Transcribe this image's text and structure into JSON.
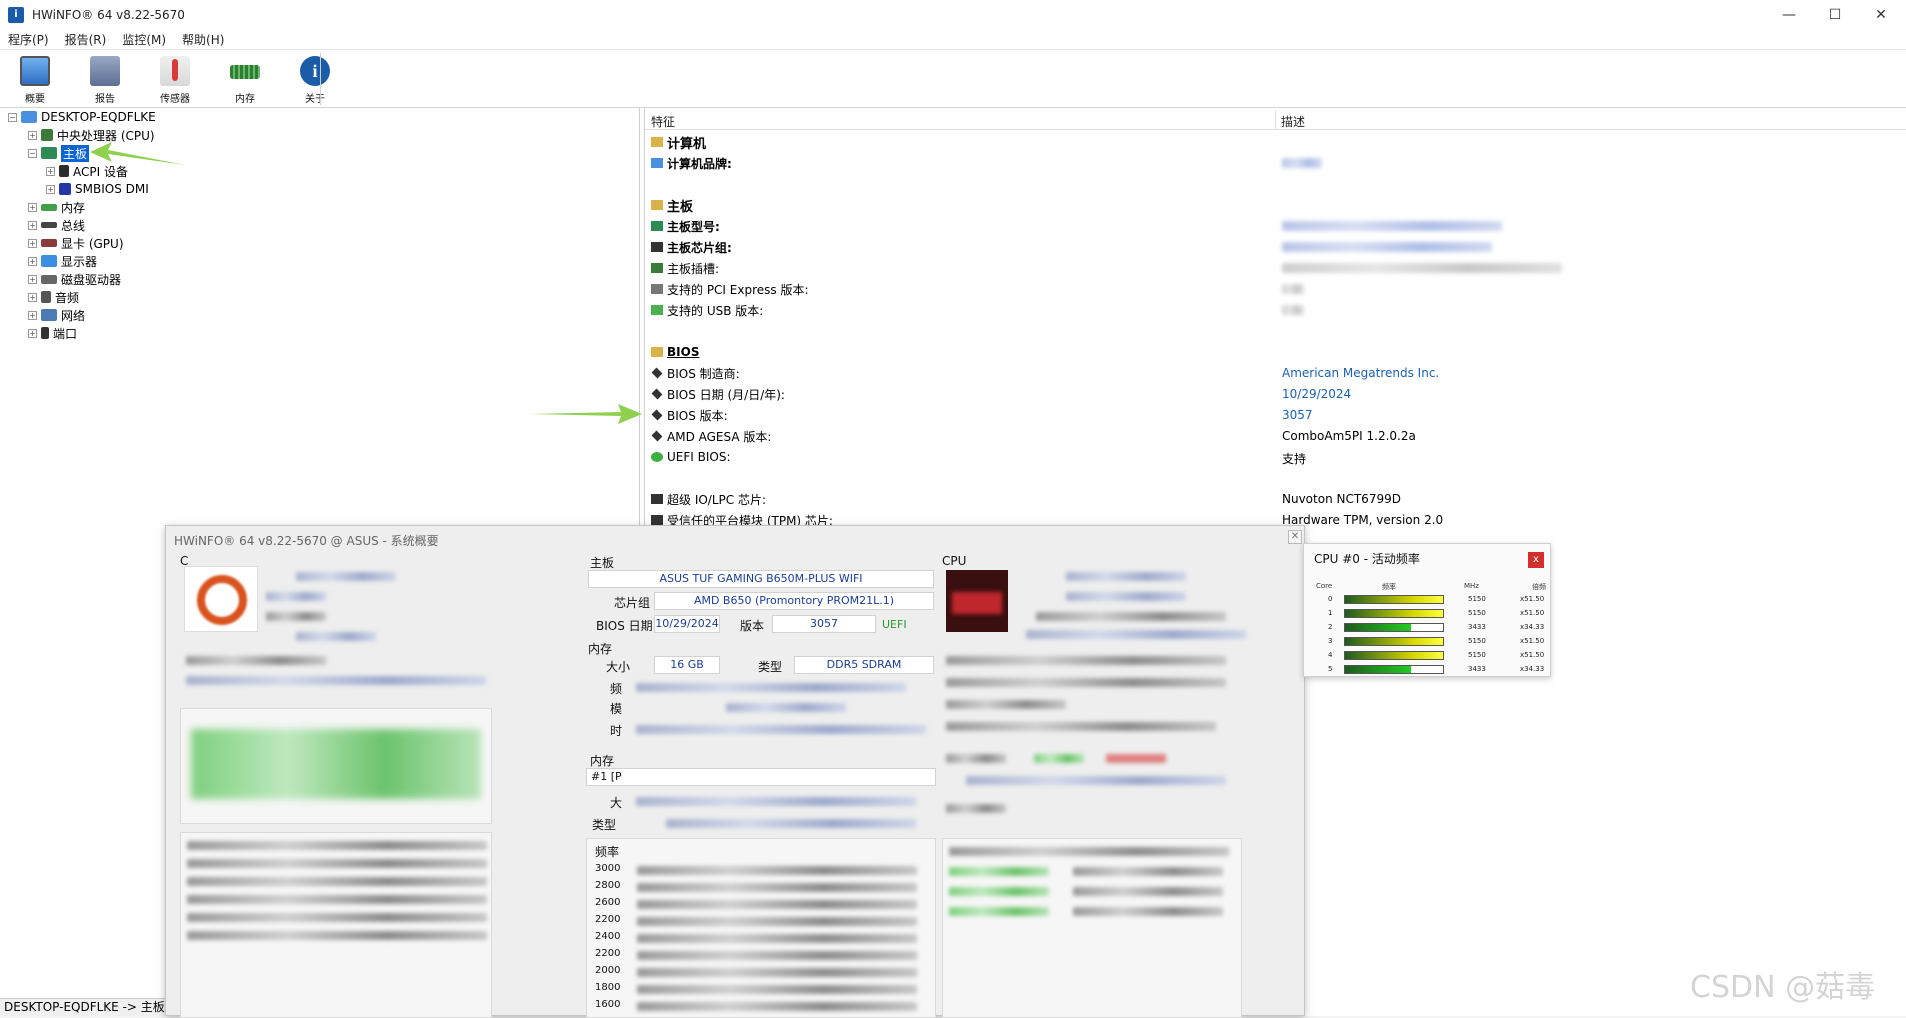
{
  "window": {
    "title": "HWiNFO® 64 v8.22-5670",
    "app_icon": "hwinfo-icon",
    "controls": {
      "minimize": "—",
      "maximize": "☐",
      "close": "✕"
    }
  },
  "menu": [
    "程序(P)",
    "报告(R)",
    "监控(M)",
    "帮助(H)"
  ],
  "toolbar": [
    {
      "label": "概要",
      "icon": "monitor-icon",
      "color": "#3a7fd5"
    },
    {
      "label": "报告",
      "icon": "floppy-icon",
      "color": "#6b7fa6"
    },
    {
      "label": "传感器",
      "icon": "thermometer-icon",
      "color": "#d83a3a"
    },
    {
      "label": "内存",
      "icon": "memory-icon",
      "color": "#3f8a3f"
    },
    {
      "label": "关于",
      "icon": "info-icon",
      "color": "#1b5ca8"
    }
  ],
  "tree": {
    "root": "DESKTOP-EQDFLKE",
    "items": [
      {
        "label": "中央处理器 (CPU)",
        "icon": "cpu-icon"
      },
      {
        "label": "主板",
        "icon": "motherboard-icon",
        "selected": true
      },
      {
        "label": "ACPI 设备",
        "icon": "acpi-icon",
        "child": true
      },
      {
        "label": "SMBIOS DMI",
        "icon": "smbios-icon",
        "child": true
      },
      {
        "label": "内存",
        "icon": "memory-icon"
      },
      {
        "label": "总线",
        "icon": "bus-icon"
      },
      {
        "label": "显卡 (GPU)",
        "icon": "gpu-icon"
      },
      {
        "label": "显示器",
        "icon": "display-icon"
      },
      {
        "label": "磁盘驱动器",
        "icon": "disk-icon"
      },
      {
        "label": "音频",
        "icon": "audio-icon"
      },
      {
        "label": "网络",
        "icon": "network-icon"
      },
      {
        "label": "端口",
        "icon": "port-icon"
      }
    ]
  },
  "detail": {
    "col_feature": "特征",
    "col_desc": "描述",
    "rows": [
      {
        "label": "计算机",
        "kind": "section",
        "icon": "folder-icon"
      },
      {
        "label": "计算机品牌:",
        "kind": "bold",
        "icon": "computer-icon",
        "value_blur": true
      },
      {
        "label": "",
        "kind": "blank"
      },
      {
        "label": "主板",
        "kind": "section",
        "icon": "folder-icon"
      },
      {
        "label": "主板型号:",
        "kind": "bold",
        "icon": "motherboard-icon",
        "value_blur": true
      },
      {
        "label": "主板芯片组:",
        "kind": "bold",
        "icon": "chip-icon",
        "value_blur": true
      },
      {
        "label": "主板插槽:",
        "kind": "normal",
        "icon": "slot-icon",
        "value_blur": true
      },
      {
        "label": "支持的 PCI Express 版本:",
        "kind": "normal",
        "icon": "pcie-icon",
        "value_blur": true
      },
      {
        "label": "支持的 USB 版本:",
        "kind": "normal",
        "icon": "usb-icon",
        "value_blur": true
      },
      {
        "label": "",
        "kind": "blank"
      },
      {
        "label": "BIOS",
        "kind": "section-u",
        "icon": "folder-icon"
      },
      {
        "label": "BIOS 制造商:",
        "kind": "normal",
        "icon": "bios-icon",
        "value": "American Megatrends Inc.",
        "blue": true
      },
      {
        "label": "BIOS 日期 (月/日/年):",
        "kind": "normal",
        "icon": "bios-icon",
        "value": "10/29/2024",
        "blue": true
      },
      {
        "label": "BIOS 版本:",
        "kind": "normal",
        "icon": "bios-icon",
        "value": "3057",
        "blue": true
      },
      {
        "label": "AMD AGESA 版本:",
        "kind": "normal",
        "icon": "bios-icon",
        "value": "ComboAm5PI 1.2.0.2a"
      },
      {
        "label": "UEFI BIOS:",
        "kind": "normal",
        "icon": "check-icon",
        "value": "支持"
      },
      {
        "label": "",
        "kind": "blank"
      },
      {
        "label": "超级 IO/LPC 芯片:",
        "kind": "normal",
        "icon": "chip-icon",
        "value": "Nuvoton NCT6799D"
      },
      {
        "label": "受信任的平台模块 (TPM) 芯片:",
        "kind": "normal",
        "icon": "chip-icon",
        "value": "Hardware TPM, version 2.0"
      }
    ]
  },
  "status": "DESKTOP-EQDFLKE -> 主板",
  "summary": {
    "title": "HWiNFO® 64 v8.22-5670 @ ASUS - 系统概要",
    "mb_section": "主板",
    "mb_model": "ASUS TUF GAMING B650M-PLUS WIFI",
    "chipset_label": "芯片组",
    "chipset": "AMD B650 (Promontory PROM21L.1)",
    "bios_date_label": "BIOS 日期",
    "bios_date": "10/29/2024",
    "version_label": "版本",
    "version": "3057",
    "uefi": "UEFI",
    "mem_section": "内存",
    "size_label": "大小",
    "size": "16 GB",
    "type_label": "类型",
    "type": "DDR5 SDRAM",
    "freq_partial": "频",
    "mode_partial": "模",
    "timing_partial": "时",
    "mem_module_partial": "内存",
    "module_item_partial": "#1 [P",
    "module_size_partial": "大",
    "module_type_partial": "类型",
    "freq_table_partial": "频率",
    "freq_rows": [
      "3000",
      "2800",
      "2600",
      "2200",
      "2400",
      "2200",
      "2000",
      "1800",
      "1600"
    ],
    "cpu_section_partial": "CPU",
    "left_section_partial": "C"
  },
  "cpu_popup": {
    "title": "CPU #0 - 活动频率",
    "headers": {
      "core": "Core",
      "freq": "频率",
      "mhz": "MHz",
      "mult": "倍频"
    },
    "rows": [
      {
        "core": "0",
        "mhz": "5150",
        "mult": "x51.50",
        "level": 1.0,
        "color": "yellow"
      },
      {
        "core": "1",
        "mhz": "5150",
        "mult": "x51.50",
        "level": 1.0,
        "color": "yellow"
      },
      {
        "core": "2",
        "mhz": "3433",
        "mult": "x34.33",
        "level": 0.67,
        "color": "green"
      },
      {
        "core": "3",
        "mhz": "5150",
        "mult": "x51.50",
        "level": 1.0,
        "color": "yellow"
      },
      {
        "core": "4",
        "mhz": "5150",
        "mult": "x51.50",
        "level": 1.0,
        "color": "yellow"
      },
      {
        "core": "5",
        "mhz": "3433",
        "mult": "x34.33",
        "level": 0.67,
        "color": "green"
      }
    ],
    "close": "x"
  },
  "watermark": "CSDN @菇毒"
}
